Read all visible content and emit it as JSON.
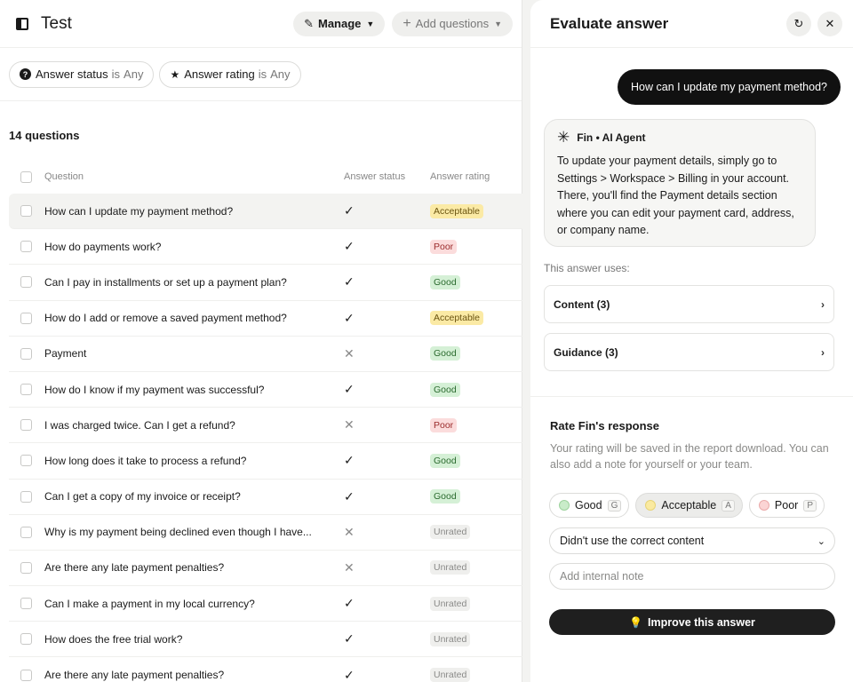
{
  "left": {
    "title": "Test",
    "manage_label": "Manage",
    "add_questions_label": "Add questions",
    "filters": [
      {
        "label": "Answer status",
        "is": "is",
        "value": "Any"
      },
      {
        "label": "Answer rating",
        "is": "is",
        "value": "Any"
      }
    ],
    "count_label": "14 questions",
    "columns": {
      "question": "Question",
      "status": "Answer status",
      "rating": "Answer rating"
    },
    "rows": [
      {
        "question": "How can I update my payment method?",
        "status": "✓",
        "rating": "Acceptable"
      },
      {
        "question": "How do payments work?",
        "status": "✓",
        "rating": "Poor"
      },
      {
        "question": "Can I pay in installments or set up a payment plan?",
        "status": "✓",
        "rating": "Good"
      },
      {
        "question": "How do I add or remove a saved payment method?",
        "status": "✓",
        "rating": "Acceptable"
      },
      {
        "question": "Payment",
        "status": "✕",
        "rating": "Good"
      },
      {
        "question": "How do I know if my payment was successful?",
        "status": "✓",
        "rating": "Good"
      },
      {
        "question": "I was charged twice. Can I get a refund?",
        "status": "✕",
        "rating": "Poor"
      },
      {
        "question": "How long does it take to process a refund?",
        "status": "✓",
        "rating": "Good"
      },
      {
        "question": "Can I get a copy of my invoice or receipt?",
        "status": "✓",
        "rating": "Good"
      },
      {
        "question": "Why is my payment being declined even though I have...",
        "status": "✕",
        "rating": "Unrated"
      },
      {
        "question": "Are there any late payment penalties?",
        "status": "✕",
        "rating": "Unrated"
      },
      {
        "question": "Can I make a payment in my local currency?",
        "status": "✓",
        "rating": "Unrated"
      },
      {
        "question": "How does the free trial work?",
        "status": "✓",
        "rating": "Unrated"
      },
      {
        "question": "Are there any late payment penalties?",
        "status": "✓",
        "rating": "Unrated"
      }
    ]
  },
  "right": {
    "title": "Evaluate answer",
    "user_message": "How can I update my payment method?",
    "agent_name": "Fin • AI Agent",
    "agent_message": "To update your payment details, simply go to Settings > Workspace > Billing in your account. There, you'll find the Payment details section where you can edit your payment card, address, or company name.",
    "uses_label": "This answer uses:",
    "sections": [
      {
        "label": "Content (3)"
      },
      {
        "label": "Guidance (3)"
      }
    ],
    "rate_title": "Rate Fin's response",
    "rate_desc": "Your rating will be saved in the report download. You can also add a note for yourself or your team.",
    "ratings": [
      {
        "label": "Good",
        "key": "G"
      },
      {
        "label": "Acceptable",
        "key": "A"
      },
      {
        "label": "Poor",
        "key": "P"
      }
    ],
    "reason_value": "Didn't use the correct content",
    "note_placeholder": "Add internal note",
    "improve_label": "Improve this answer"
  }
}
